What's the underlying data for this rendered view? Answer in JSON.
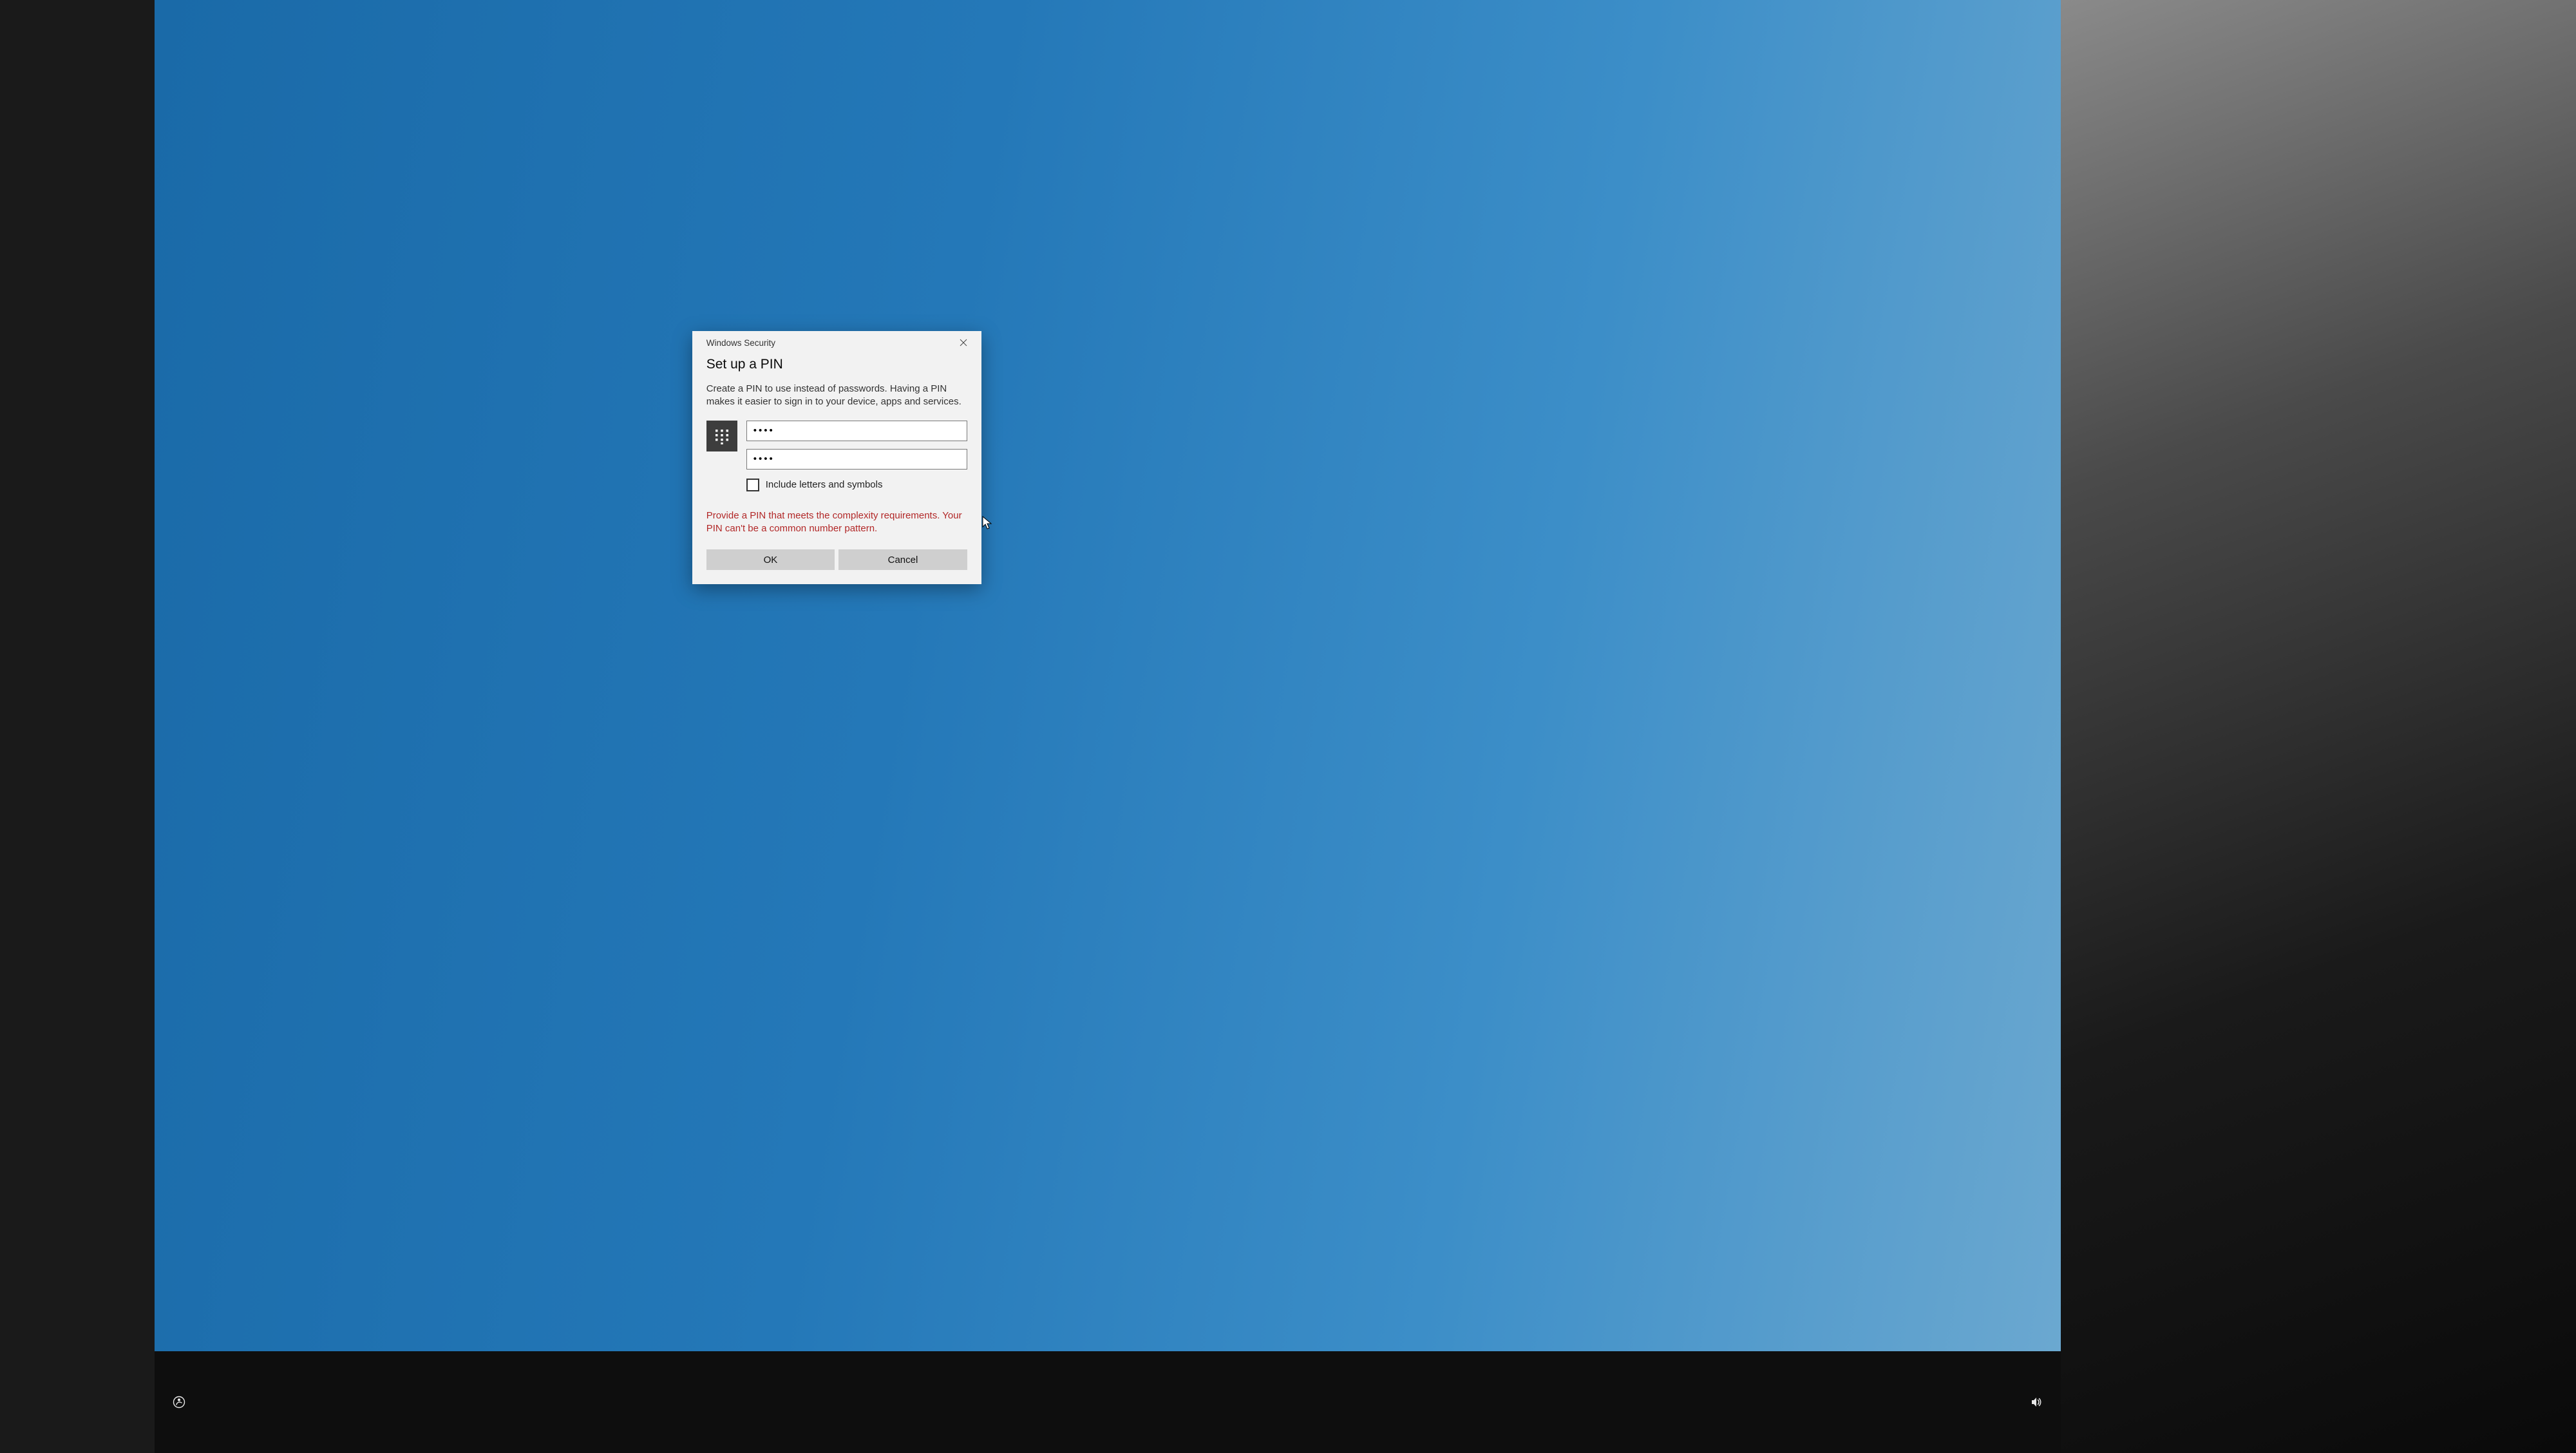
{
  "dialog": {
    "window_title": "Windows Security",
    "heading": "Set up a PIN",
    "description": "Create a PIN to use instead of passwords. Having a PIN makes it easier to sign in to your device, apps and services.",
    "pin_value": "••••",
    "confirm_pin_value": "••••",
    "checkbox_label": "Include letters and symbols",
    "checkbox_checked": false,
    "error_message": "Provide a PIN that meets the complexity requirements. Your PIN can't be a common number pattern.",
    "ok_label": "OK",
    "cancel_label": "Cancel"
  },
  "colors": {
    "desktop_bg": "#2478b8",
    "dialog_bg": "#f2f2f2",
    "error": "#b22828",
    "icon_box": "#3d3d3d",
    "button_bg": "#cfcfcf"
  }
}
